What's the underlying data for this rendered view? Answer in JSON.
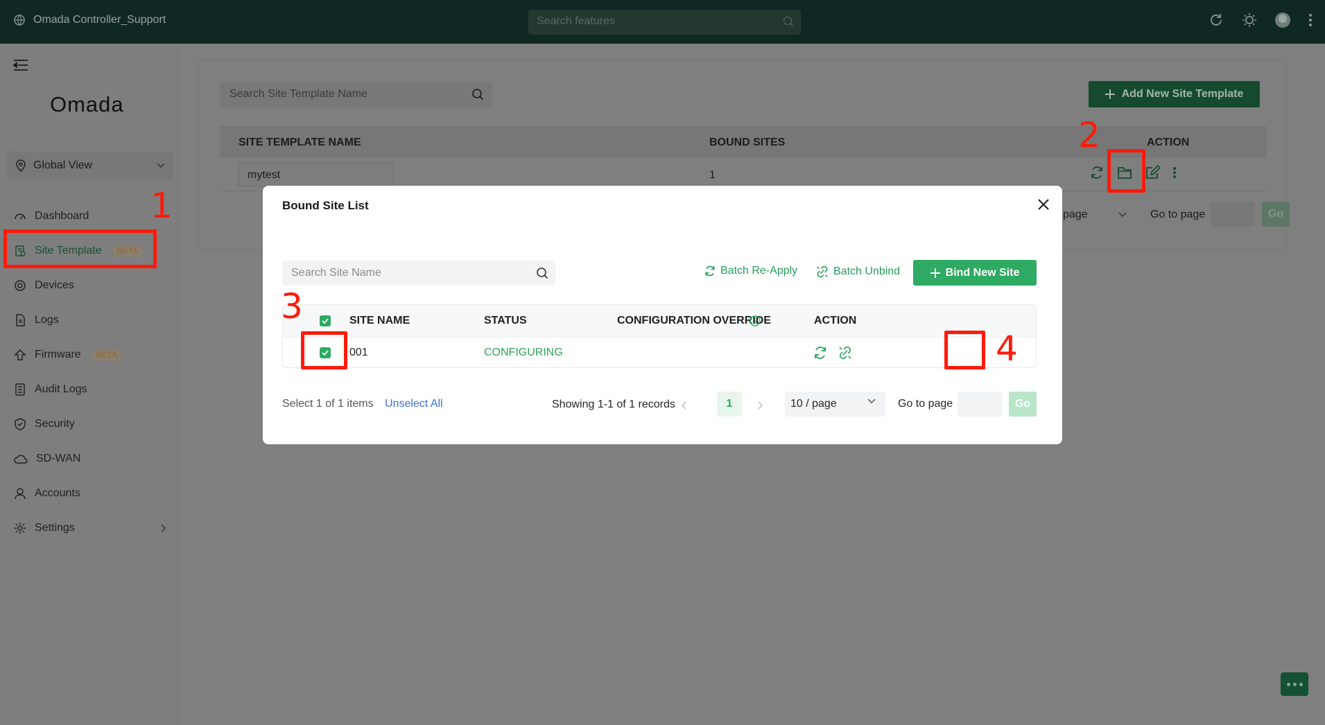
{
  "topbar": {
    "app_name": "Omada Controller_Support",
    "search_placeholder": "Search features"
  },
  "sidebar": {
    "logo": "Omada",
    "scope": "Global View",
    "items": [
      {
        "label": "Dashboard",
        "icon": "dashboard-icon"
      },
      {
        "label": "Site Template",
        "badge": "BETA",
        "icon": "site-template-icon"
      },
      {
        "label": "Devices",
        "icon": "devices-icon"
      },
      {
        "label": "Logs",
        "icon": "logs-icon"
      },
      {
        "label": "Firmware",
        "badge": "BETA",
        "icon": "firmware-icon"
      },
      {
        "label": "Audit Logs",
        "icon": "audit-logs-icon"
      },
      {
        "label": "Security",
        "icon": "shield-icon"
      },
      {
        "label": "SD-WAN",
        "icon": "cloud-icon"
      },
      {
        "label": "Accounts",
        "icon": "user-icon"
      },
      {
        "label": "Settings",
        "icon": "gear-icon"
      }
    ]
  },
  "main": {
    "search_placeholder": "Search Site Template Name",
    "add_button": "Add New Site Template",
    "columns": [
      "SITE TEMPLATE NAME",
      "BOUND SITES",
      "ACTION"
    ],
    "rows": [
      {
        "name": "mytest",
        "bound_sites": "1"
      }
    ],
    "pager": {
      "page_size_partial": "page",
      "goto_label": "Go to page",
      "go": "Go"
    }
  },
  "modal": {
    "title": "Bound Site List",
    "search_placeholder": "Search Site Name",
    "batch_reapply": "Batch Re-Apply",
    "batch_unbind": "Batch Unbind",
    "bind_button": "Bind New Site",
    "columns": [
      "SITE NAME",
      "STATUS",
      "CONFIGURATION OVERRIDE",
      "ACTION"
    ],
    "rows": [
      {
        "site_name": "001",
        "status": "CONFIGURING",
        "override": ""
      }
    ],
    "footer": {
      "selected": "Select 1 of 1 items",
      "unselect": "Unselect All",
      "showing": "Showing 1-1 of 1 records",
      "current_page": "1",
      "page_size": "10 / page",
      "goto_label": "Go to page",
      "go": "Go"
    }
  },
  "annotations": [
    "1",
    "2",
    "3",
    "4"
  ],
  "colors": {
    "brand_green": "#2eaa62",
    "annotation_red": "#ff1a0a",
    "topbar": "#102824"
  }
}
